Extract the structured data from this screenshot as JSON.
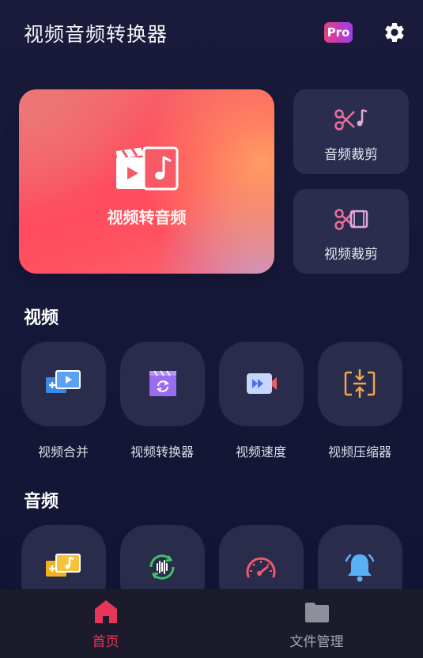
{
  "header": {
    "title": "视频音频转换器",
    "pro_badge": "Pro"
  },
  "hero": {
    "label": "视频转音频"
  },
  "side_cards": [
    {
      "label": "音频裁剪"
    },
    {
      "label": "视频裁剪"
    }
  ],
  "sections": {
    "video": {
      "title": "视频",
      "tools": [
        {
          "label": "视频合并",
          "icon": "video-merge-icon"
        },
        {
          "label": "视频转换器",
          "icon": "video-convert-icon"
        },
        {
          "label": "视频速度",
          "icon": "video-speed-icon"
        },
        {
          "label": "视频压缩器",
          "icon": "video-compress-icon"
        }
      ]
    },
    "audio": {
      "title": "音频",
      "tools": [
        {
          "icon": "audio-merge-icon"
        },
        {
          "icon": "audio-convert-icon"
        },
        {
          "icon": "audio-speed-icon"
        },
        {
          "icon": "ringtone-bell-icon"
        }
      ]
    }
  },
  "bottom_nav": {
    "items": [
      {
        "label": "首页",
        "active": true
      },
      {
        "label": "文件管理",
        "active": false
      }
    ]
  },
  "colors": {
    "accent": "#e8365a",
    "card": "#2b2d4e",
    "background": "#16183a",
    "nav_inactive": "#a7a7b4"
  }
}
